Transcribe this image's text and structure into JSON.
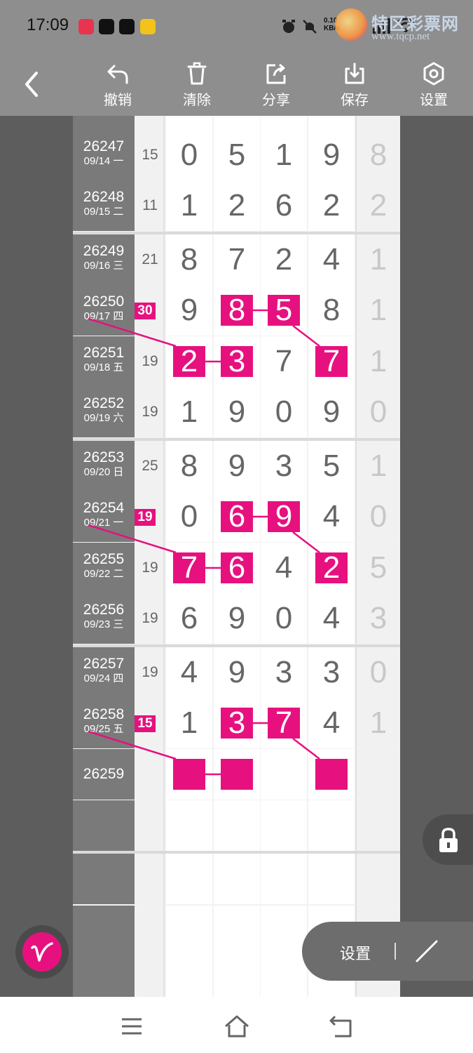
{
  "status_bar": {
    "time": "17:09",
    "net_speed_value": "0.10",
    "net_speed_unit": "KB/s",
    "watermark_cn": "特区彩票网",
    "watermark_url": "www.tqcp.net"
  },
  "toolbar": {
    "items": [
      {
        "label": "撤销",
        "icon": "undo-icon"
      },
      {
        "label": "清除",
        "icon": "trash-icon"
      },
      {
        "label": "分享",
        "icon": "share-icon"
      },
      {
        "label": "保存",
        "icon": "download-icon"
      },
      {
        "label": "设置",
        "icon": "settings-hex-icon"
      }
    ]
  },
  "colors": {
    "highlight": "#e6117f",
    "period_bg": "#7a7a7a",
    "toolbar_bg": "#8e8e8e"
  },
  "rows": [
    {
      "issue": "26247",
      "date": "09/14 一",
      "sum": "15",
      "digits": [
        "0",
        "5",
        "1",
        "9"
      ],
      "extra": "8"
    },
    {
      "issue": "26248",
      "date": "09/15 二",
      "sum": "11",
      "digits": [
        "1",
        "2",
        "6",
        "2"
      ],
      "extra": "2"
    },
    {
      "issue": "26249",
      "date": "09/16 三",
      "sum": "21",
      "digits": [
        "8",
        "7",
        "2",
        "4"
      ],
      "extra": "1"
    },
    {
      "issue": "26250",
      "date": "09/17 四",
      "sum": "",
      "badge": "30",
      "digits": [
        "9",
        "8",
        "5",
        "8"
      ],
      "extra": "1",
      "hl": [
        1,
        2
      ]
    },
    {
      "issue": "26251",
      "date": "09/18 五",
      "sum": "19",
      "digits": [
        "2",
        "3",
        "7",
        "7"
      ],
      "extra": "1",
      "hl": [
        0,
        1,
        3
      ]
    },
    {
      "issue": "26252",
      "date": "09/19 六",
      "sum": "19",
      "digits": [
        "1",
        "9",
        "0",
        "9"
      ],
      "extra": "0"
    },
    {
      "issue": "26253",
      "date": "09/20 日",
      "sum": "25",
      "digits": [
        "8",
        "9",
        "3",
        "5"
      ],
      "extra": "1"
    },
    {
      "issue": "26254",
      "date": "09/21 一",
      "sum": "",
      "badge": "19",
      "digits": [
        "0",
        "6",
        "9",
        "4"
      ],
      "extra": "0",
      "hl": [
        1,
        2
      ]
    },
    {
      "issue": "26255",
      "date": "09/22 二",
      "sum": "19",
      "digits": [
        "7",
        "6",
        "4",
        "2"
      ],
      "extra": "5",
      "hl": [
        0,
        1,
        3
      ]
    },
    {
      "issue": "26256",
      "date": "09/23 三",
      "sum": "19",
      "digits": [
        "6",
        "9",
        "0",
        "4"
      ],
      "extra": "3"
    },
    {
      "issue": "26257",
      "date": "09/24 四",
      "sum": "19",
      "digits": [
        "4",
        "9",
        "3",
        "3"
      ],
      "extra": "0"
    },
    {
      "issue": "26258",
      "date": "09/25 五",
      "sum": "",
      "badge": "15",
      "digits": [
        "1",
        "3",
        "7",
        "4"
      ],
      "extra": "1",
      "hl": [
        1,
        2
      ]
    },
    {
      "issue": "26259",
      "date": "",
      "sum": "",
      "digits": [
        "",
        "",
        "",
        ""
      ],
      "extra": "",
      "hl": [
        0,
        1,
        3
      ]
    }
  ],
  "floating": {
    "settings_label": "设置"
  }
}
